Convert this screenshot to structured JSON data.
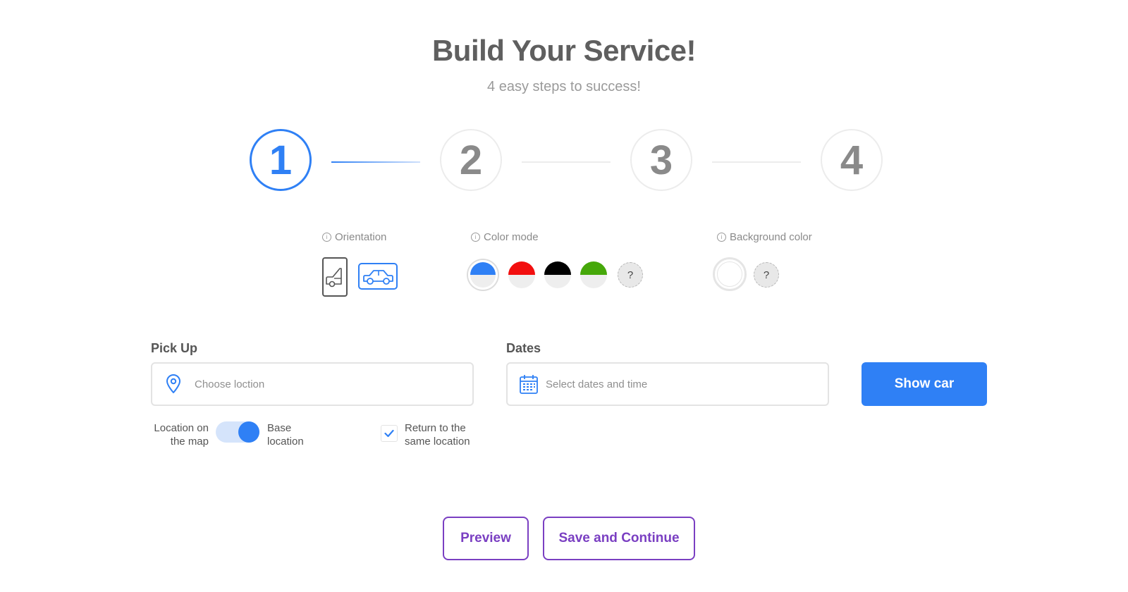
{
  "header": {
    "title": "Build Your Service!",
    "subtitle": "4 easy steps to success!"
  },
  "stepper": {
    "steps": [
      "1",
      "2",
      "3",
      "4"
    ],
    "active_step": 1
  },
  "options": {
    "orientation_label": "Orientation",
    "color_mode_label": "Color mode",
    "background_color_label": "Background color",
    "info_icon": "ⓘ",
    "color_swatches": [
      "#2f80f5",
      "#f20f0f",
      "#000000",
      "#46a80a"
    ],
    "question_mark": "?"
  },
  "form": {
    "pickup_label": "Pick Up",
    "pickup_placeholder": "Choose loction",
    "dates_label": "Dates",
    "dates_placeholder": "Select dates and time",
    "show_car_label": "Show car",
    "toggle_left_label_line1": "Location on",
    "toggle_left_label_line2": "the map",
    "toggle_right_label_line1": "Base",
    "toggle_right_label_line2": "location",
    "return_label_line1": "Return to the",
    "return_label_line2": "same location"
  },
  "footer": {
    "preview_label": "Preview",
    "save_label": "Save and Continue"
  },
  "colors": {
    "accent": "#2f80f5",
    "purple": "#7a3fc2"
  }
}
